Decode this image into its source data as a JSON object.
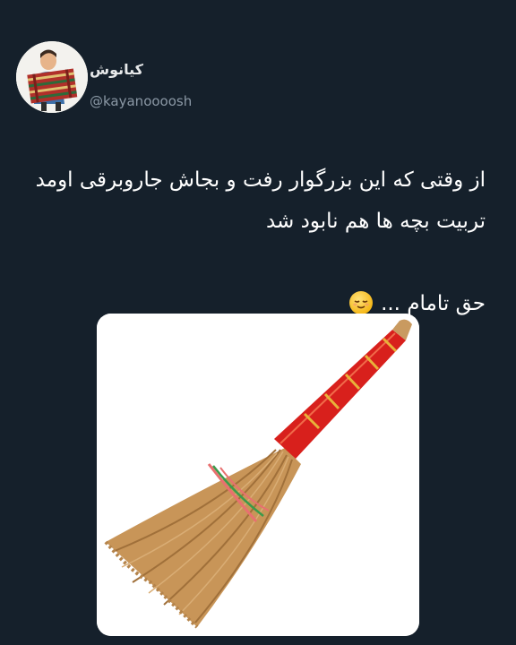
{
  "author": {
    "display_name": "کیانوش",
    "handle": "@kayanoooosh",
    "avatar_icon": "illustrated-man-with-striped-rug-avatar"
  },
  "tweet": {
    "line1": "از وقتی که این بزرگوار رفت و بجاش جاروبرقی اومد",
    "line2": "تربیت بچه ها هم نابود شد",
    "line3": "حق تامام ...",
    "emoji": "relieved-face-emoji"
  },
  "media": {
    "image_icon": "straw-broom-with-red-handle"
  },
  "colors": {
    "background": "#15202b",
    "text": "#ffffff",
    "secondary_text": "#8b98a5",
    "broom_handle_red": "#d8201c",
    "broom_straw": "#c8955a"
  }
}
